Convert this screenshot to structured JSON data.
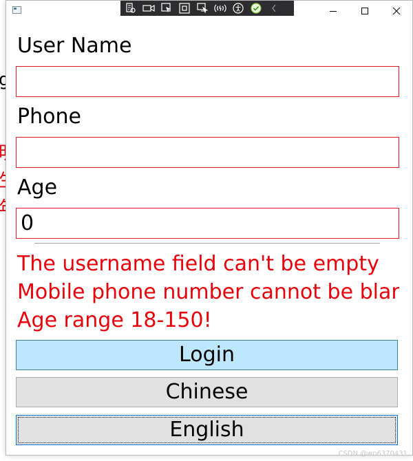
{
  "background_fragments": [
    "g",
    "明",
    "生",
    "年"
  ],
  "window": {
    "title": "",
    "controls": {
      "minimize": "minimize",
      "maximize": "maximize",
      "close": "close"
    }
  },
  "dev_toolbar": {
    "tools": [
      "live-visual-tree-icon",
      "record-icon",
      "select-element-icon",
      "display-layout-adorners-icon",
      "track-focus-icon",
      "hot-reload-icon",
      "accessibility-icon",
      "status-check-icon",
      "collapse-icon"
    ]
  },
  "form": {
    "username_label": "User Name",
    "username_value": "",
    "phone_label": "Phone",
    "phone_value": "",
    "age_label": "Age",
    "age_value": "0"
  },
  "errors": [
    "The username field can't be empty",
    "Mobile phone number cannot be blank",
    "Age range 18-150!"
  ],
  "buttons": {
    "login": "Login",
    "chinese": "Chinese",
    "english": "English"
  },
  "watermark": "CSDN @wo6370431",
  "colors": {
    "error": "#e8000b",
    "field_border": "#e01b24",
    "login_bg": "#bee6fd",
    "button_bg": "#e1e1e1",
    "toolbar_bg": "#2d2d30"
  }
}
